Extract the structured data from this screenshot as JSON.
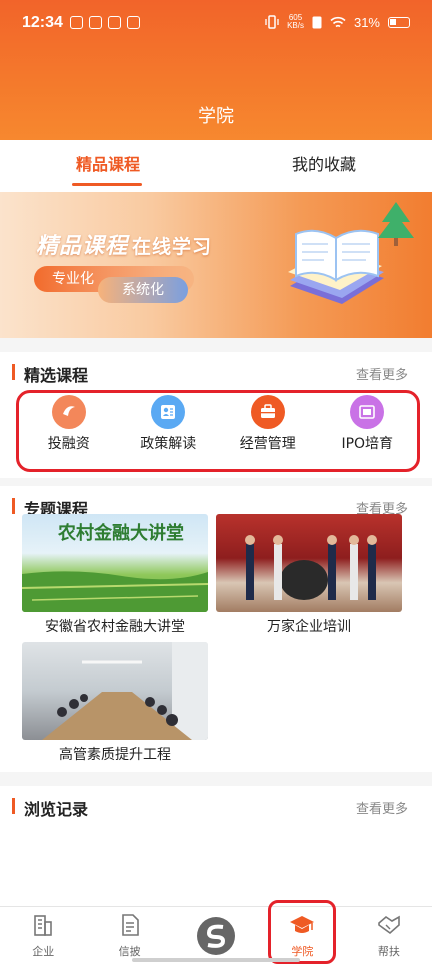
{
  "status_bar": {
    "time": "12:34",
    "net_speed_value": "605",
    "net_speed_unit": "KB/s",
    "battery": "31%"
  },
  "header": {
    "title": "学院"
  },
  "tabs": [
    {
      "label": "精品课程",
      "active": true
    },
    {
      "label": "我的收藏",
      "active": false
    }
  ],
  "banner": {
    "title": "精品课程",
    "subtitle": "在线学习",
    "tag1": "专业化",
    "tag2": "系统化"
  },
  "featured": {
    "title": "精选课程",
    "more": "查看更多",
    "categories": [
      {
        "label": "投融资",
        "icon": "finance-icon",
        "color": "#f07a4a"
      },
      {
        "label": "政策解读",
        "icon": "policy-icon",
        "color": "#4a9df0"
      },
      {
        "label": "经营管理",
        "icon": "briefcase-icon",
        "color": "#ef5a24"
      },
      {
        "label": "IPO培育",
        "icon": "ipo-icon",
        "color": "#c46ae0"
      }
    ]
  },
  "topics": {
    "title": "专题课程",
    "more": "查看更多",
    "courses": [
      {
        "label": "安徽省农村金融大讲堂",
        "image_text": "农村金融大讲堂"
      },
      {
        "label": "万家企业培训"
      },
      {
        "label": "高管素质提升工程"
      }
    ]
  },
  "history": {
    "title": "浏览记录",
    "more": "查看更多"
  },
  "bottom_nav": [
    {
      "label": "企业",
      "icon": "building-icon"
    },
    {
      "label": "信披",
      "icon": "document-icon"
    },
    {
      "label": "",
      "icon": "logo-icon"
    },
    {
      "label": "学院",
      "icon": "graduation-cap-icon",
      "active": true
    },
    {
      "label": "帮扶",
      "icon": "handshake-icon"
    }
  ]
}
